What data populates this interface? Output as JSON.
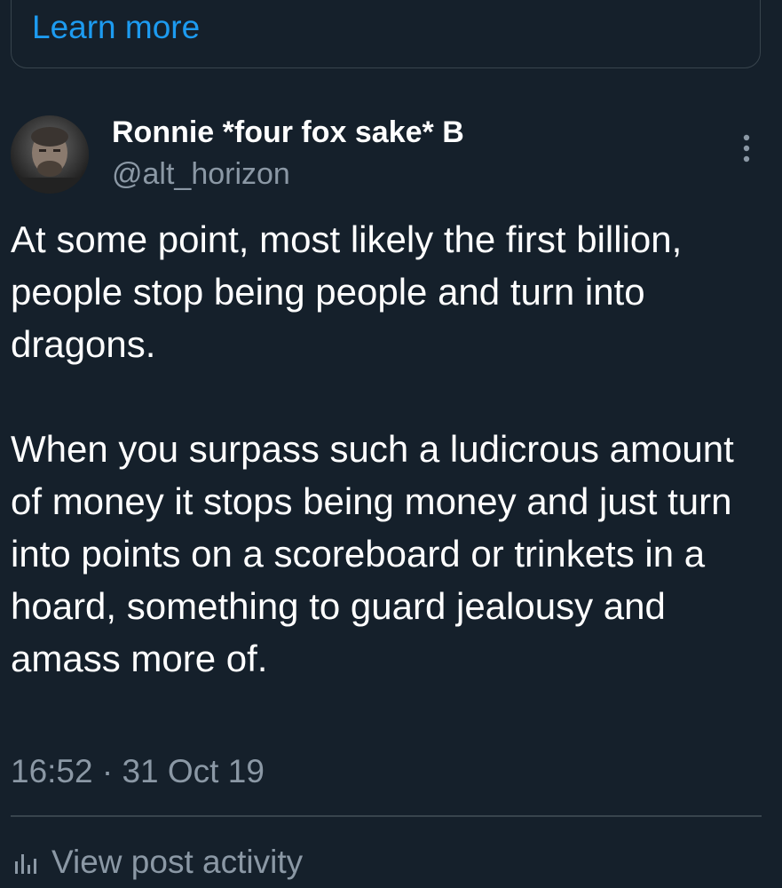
{
  "notice": {
    "learn_more_label": "Learn more"
  },
  "post": {
    "author": {
      "display_name": "Ronnie *four fox sake* B",
      "handle": "@alt_horizon"
    },
    "text_paragraphs": [
      "At some point, most likely the first billion, people stop being people and turn into dragons.",
      "When you surpass such a ludicrous amount of money it stops being money and just turn into points on a scoreboard or trinkets in a hoard, something to guard jealousy and amass more of."
    ],
    "timestamp": "16:52 · 31 Oct 19"
  },
  "footer": {
    "view_activity_label": "View post activity",
    "view_activity_icon": "bar-chart-icon"
  },
  "colors": {
    "background": "#15202b",
    "accent": "#1d9bf0",
    "secondary_text": "#8b98a5",
    "border": "#38444d"
  }
}
